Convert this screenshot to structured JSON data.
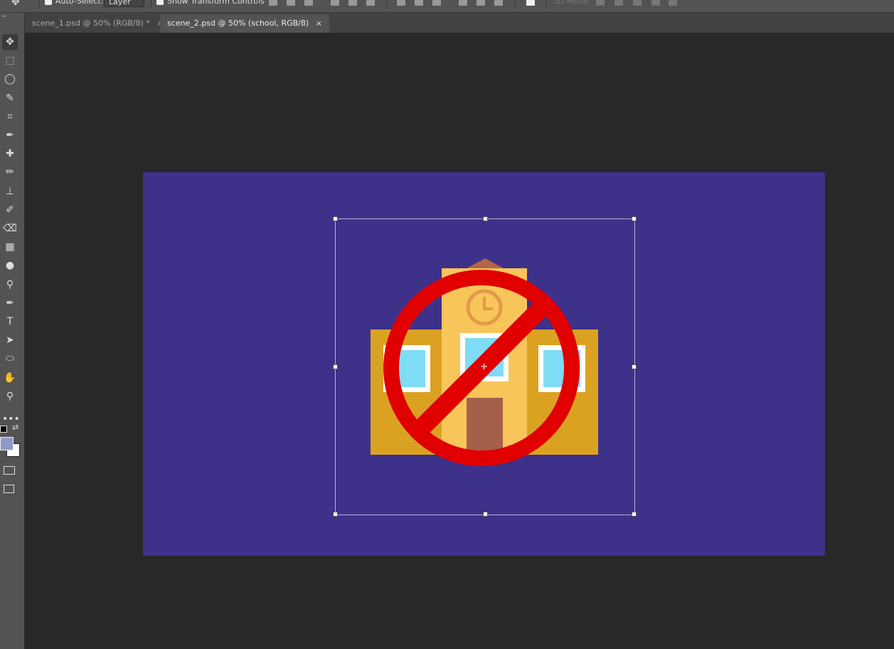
{
  "options_bar": {
    "auto_select_label": "Auto-Select:",
    "auto_select_checked": true,
    "auto_select_target": "Layer",
    "show_transform_label": "Show Transform Controls",
    "show_transform_checked": true,
    "mode_3d_label": "3D Mode:"
  },
  "tabs": [
    {
      "label": "scene_1.psd @ 50% (RGB/8) *",
      "active": false
    },
    {
      "label": "scene_2.psd @ 50% (school, RGB/8)",
      "active": true
    }
  ],
  "close_glyph": "×",
  "tools": [
    {
      "name": "move-tool",
      "glyph": "✥"
    },
    {
      "name": "marquee-tool",
      "glyph": "⬚"
    },
    {
      "name": "lasso-tool",
      "glyph": "◯"
    },
    {
      "name": "quick-selection-tool",
      "glyph": "✎"
    },
    {
      "name": "crop-tool",
      "glyph": "⌗"
    },
    {
      "name": "eyedropper-tool",
      "glyph": "✒"
    },
    {
      "name": "healing-brush-tool",
      "glyph": "✚"
    },
    {
      "name": "brush-tool",
      "glyph": "✏"
    },
    {
      "name": "clone-stamp-tool",
      "glyph": "⊥"
    },
    {
      "name": "history-brush-tool",
      "glyph": "✐"
    },
    {
      "name": "eraser-tool",
      "glyph": "⌫"
    },
    {
      "name": "gradient-tool",
      "glyph": "▦"
    },
    {
      "name": "blur-tool",
      "glyph": "●"
    },
    {
      "name": "dodge-tool",
      "glyph": "⚲"
    },
    {
      "name": "pen-tool",
      "glyph": "✒"
    },
    {
      "name": "type-tool",
      "glyph": "T"
    },
    {
      "name": "path-selection-tool",
      "glyph": "➤"
    },
    {
      "name": "ellipse-tool",
      "glyph": "⬭"
    },
    {
      "name": "hand-tool",
      "glyph": "✋"
    },
    {
      "name": "zoom-tool",
      "glyph": "⚲"
    },
    {
      "name": "more-tools",
      "glyph": "•••"
    }
  ],
  "colors": {
    "foreground": "#8f9ac9",
    "background": "#ffffff",
    "canvas_bg": "#3d318a",
    "prohibition": "#e00000"
  }
}
